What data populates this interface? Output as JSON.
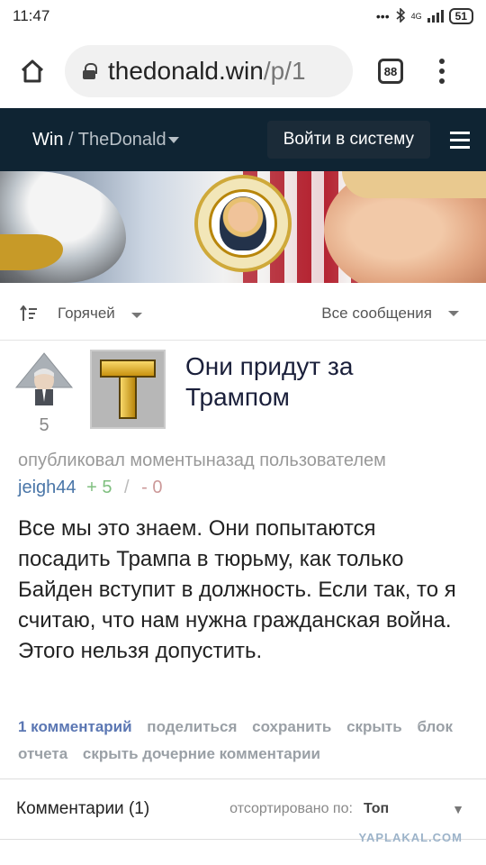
{
  "status_bar": {
    "time": "11:47",
    "network": "4G",
    "battery": "51"
  },
  "browser": {
    "url_host": "thedonald.win",
    "url_path": "/p/1",
    "tab_count": "88"
  },
  "site_header": {
    "brand": "Win",
    "separator": "/",
    "community": "TheDonald",
    "login_label": "Войти в систему"
  },
  "sort_bar": {
    "sort_label": "Горячей",
    "filter_label": "Все сообщения"
  },
  "post": {
    "score": "5",
    "title": "Они придут за Трампом",
    "meta_prefix": "опубликовал моментыназад пользователем",
    "author": "jeigh44",
    "upvotes": "+ 5",
    "divider": "/",
    "downvotes": "- 0",
    "body": "Все мы это знаем. Они попытаются посадить Трампа в тюрьму, как только Байден вступит в должность. Если так, то я считаю, что нам нужна гражданская война. Этого нельзя допустить.",
    "actions": {
      "comments": "1 комментарий",
      "share": "поделиться",
      "save": "сохранить",
      "hide": "скрыть",
      "block": "блок",
      "report": "отчета",
      "hide_children": "скрыть дочерние комментарии"
    }
  },
  "comments_bar": {
    "count_label": "Комментарии (1)",
    "sorted_label": "отсортировано по:",
    "sort_value": "Топ"
  },
  "watermark": "YAPLAKAL.COM",
  "colors": {
    "header_bg": "#0f2433",
    "link_blue": "#4a76a8",
    "title": "#1a1f3a"
  },
  "icons": [
    "home-icon",
    "lock-icon",
    "tabs-icon",
    "more-vert-icon",
    "hamburger-icon",
    "sort-icon",
    "upvote-icon"
  ]
}
